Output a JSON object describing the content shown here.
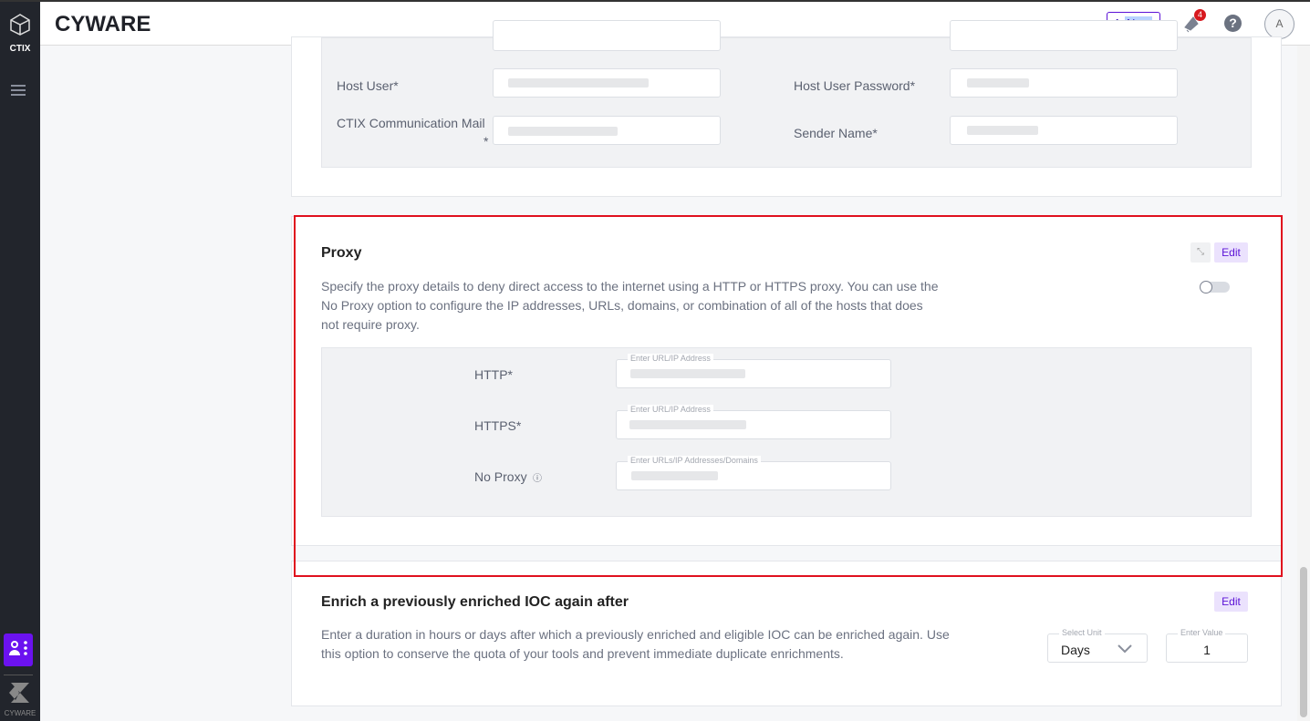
{
  "sidebar": {
    "app_label": "CTIX",
    "brand_label": "CYWARE",
    "accent": "#6b12f0"
  },
  "header": {
    "title": "CYWARE",
    "new_label": "New",
    "notification_count": "4",
    "help_icon": "?",
    "avatar_initial": "A"
  },
  "email_settings": {
    "fields": [
      {
        "label": "Host User*"
      },
      {
        "label": "Host User Password*"
      },
      {
        "label": "CTIX Communication Mail"
      },
      {
        "label": "Sender Name*"
      }
    ],
    "mail_asterisk": "*"
  },
  "proxy": {
    "title": "Proxy",
    "edit_label": "Edit",
    "enabled": false,
    "description": "Specify the proxy details to deny direct access to the internet using a HTTP or HTTPS proxy. You can use the No Proxy option to configure the IP addresses, URLs, domains, or combination of all of the hosts that does not require proxy.",
    "fields": [
      {
        "label": "HTTP*",
        "legend": "Enter URL/IP Address"
      },
      {
        "label": "HTTPS*",
        "legend": "Enter URL/IP Address"
      },
      {
        "label": "No Proxy",
        "legend": "Enter URLs/IP Addresses/Domains",
        "info_icon": "ⓘ"
      }
    ]
  },
  "enrich": {
    "title": "Enrich a previously enriched IOC again after",
    "edit_label": "Edit",
    "description": "Enter a duration in hours or days after which a previously enriched and eligible IOC can be enriched again. Use this option to conserve the quota of your tools and prevent immediate duplicate enrichments.",
    "unit_legend": "Select Unit",
    "unit_value": "Days",
    "value_legend": "Enter Value",
    "value": "1"
  }
}
